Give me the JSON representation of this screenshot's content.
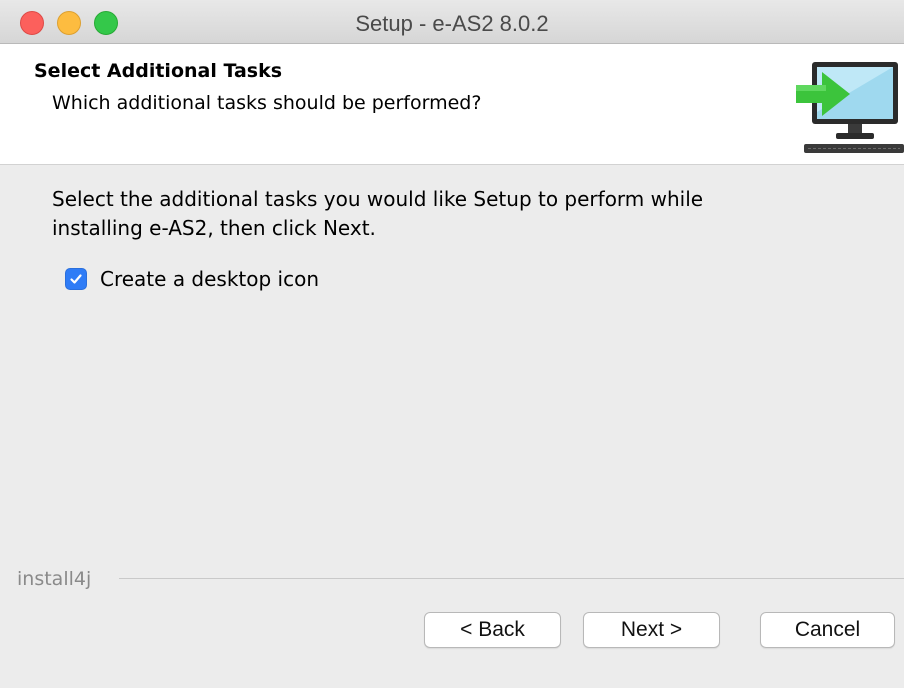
{
  "window": {
    "title": "Setup - e-AS2 8.0.2"
  },
  "header": {
    "title": "Select Additional Tasks",
    "subtitle": "Which additional tasks should be performed?",
    "icon": "installer-monitor-arrow-icon"
  },
  "content": {
    "instruction_line1": "Select the additional tasks you would like Setup to perform while",
    "instruction_line2": "installing e-AS2, then click Next.",
    "tasks": [
      {
        "label": "Create a desktop icon",
        "checked": true
      }
    ]
  },
  "footer": {
    "brand": "install4j",
    "back_label": "< Back",
    "next_label": "Next >",
    "cancel_label": "Cancel"
  },
  "colors": {
    "checkbox_accent": "#2f7cf6",
    "icon_arrow": "#3cc43c",
    "icon_screen": "#9fd9ef"
  }
}
